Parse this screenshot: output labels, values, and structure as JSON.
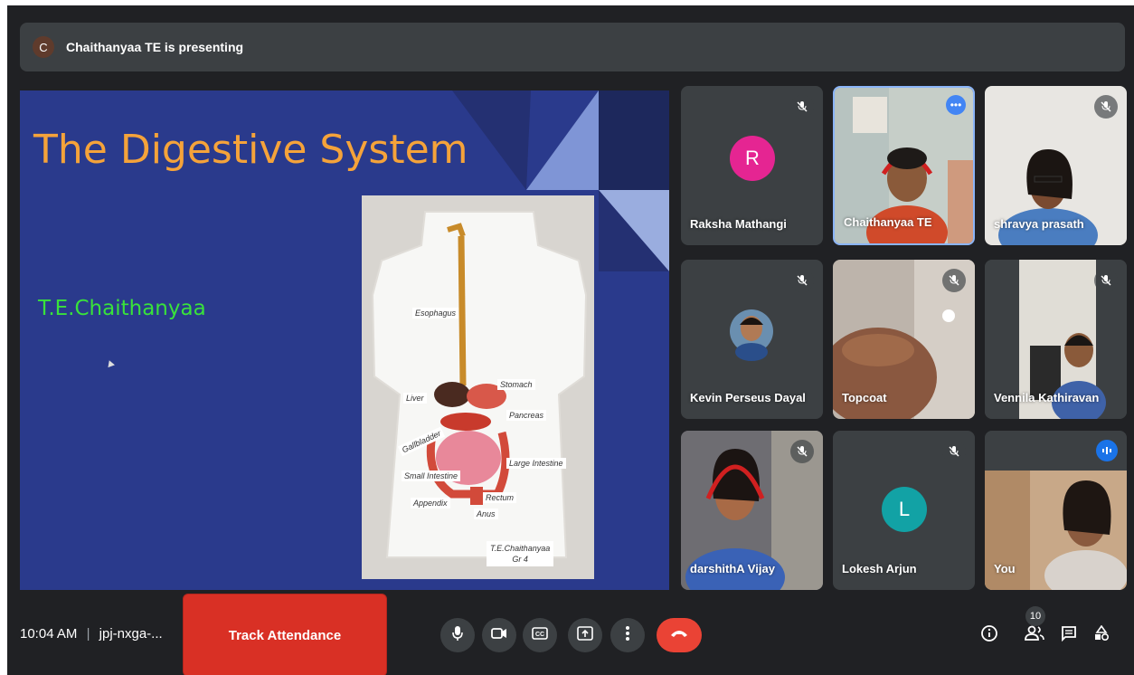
{
  "presenting": {
    "avatar_letter": "C",
    "text": "Chaithanyaa TE is presenting"
  },
  "slide": {
    "title": "The Digestive System",
    "author": "T.E.Chaithanyaa",
    "model_labels": [
      "Esophagus",
      "Stomach",
      "Liver",
      "Pancreas",
      "Gallbladder",
      "Small Intestine",
      "Large Intestine",
      "Appendix",
      "Rectum",
      "Anus"
    ],
    "model_signature": "T.E.Chaithanyaa",
    "model_signature_line2": "Gr 4"
  },
  "participants": [
    {
      "name": "Raksha Mathangi",
      "avatar": "R",
      "avatar_color": "#e52592",
      "muted": true
    },
    {
      "name": "Chaithanyaa TE",
      "muted": false,
      "more_options": true
    },
    {
      "name": "shravya prasath",
      "muted": true
    },
    {
      "name": "Kevin Perseus Dayal",
      "muted": true
    },
    {
      "name": "Topcoat",
      "muted": true
    },
    {
      "name": "Vennila Kathiravan",
      "muted": true
    },
    {
      "name": "darshithA Vijay",
      "muted": true
    },
    {
      "name": "Lokesh Arjun",
      "avatar": "L",
      "avatar_color": "#12a2a5",
      "muted": true
    },
    {
      "name": "You",
      "speaking": true
    }
  ],
  "bottom_bar": {
    "time": "10:04 AM",
    "meeting_code": "jpj-nxga-...",
    "track_attendance": "Track Attendance",
    "participants_count": "10"
  },
  "icons": [
    "microphone-icon",
    "camera-icon",
    "captions-icon",
    "present-icon",
    "more-vert-icon",
    "hang-up-icon",
    "info-icon",
    "people-icon",
    "chat-icon",
    "activities-icon"
  ]
}
